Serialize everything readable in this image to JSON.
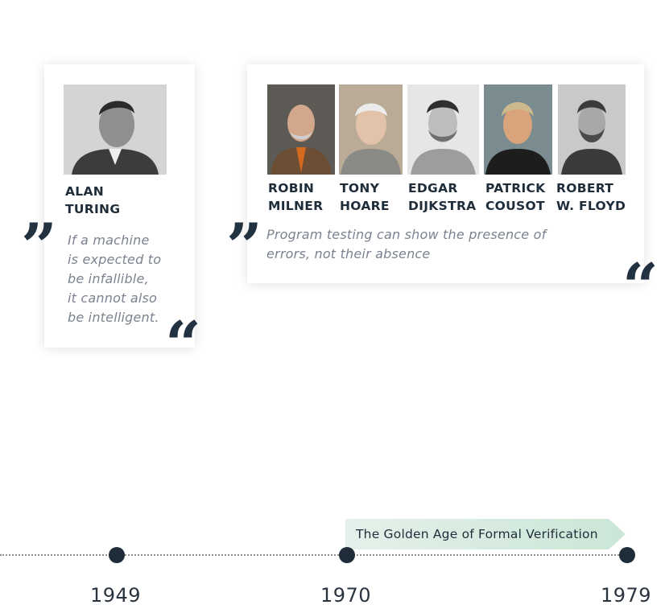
{
  "turing": {
    "name_line1": "ALAN",
    "name_line2": "TURING",
    "quote_lines": [
      "If a machine",
      "is expected to",
      "be infallible,",
      "it cannot also",
      "be intelligent."
    ]
  },
  "group": {
    "people": [
      {
        "line1": "ROBIN",
        "line2": "MILNER"
      },
      {
        "line1": "TONY",
        "line2": "HOARE"
      },
      {
        "line1": "EDGAR",
        "line2": "DIJKSTRA"
      },
      {
        "line1": "PATRICK",
        "line2": "COUSOT"
      },
      {
        "line1": "ROBERT",
        "line2": "W. FLOYD"
      }
    ],
    "quote_lines": [
      "Program testing can show the presence of",
      "errors, not their absence"
    ]
  },
  "quote_marks": {
    "open": "”",
    "close": "“"
  },
  "timeline": {
    "years": [
      "1949",
      "1970",
      "1979"
    ],
    "era_label": "The Golden Age of Formal Verification",
    "dot_color": "#1f2d3a",
    "era_color": "#cbe5d6"
  }
}
